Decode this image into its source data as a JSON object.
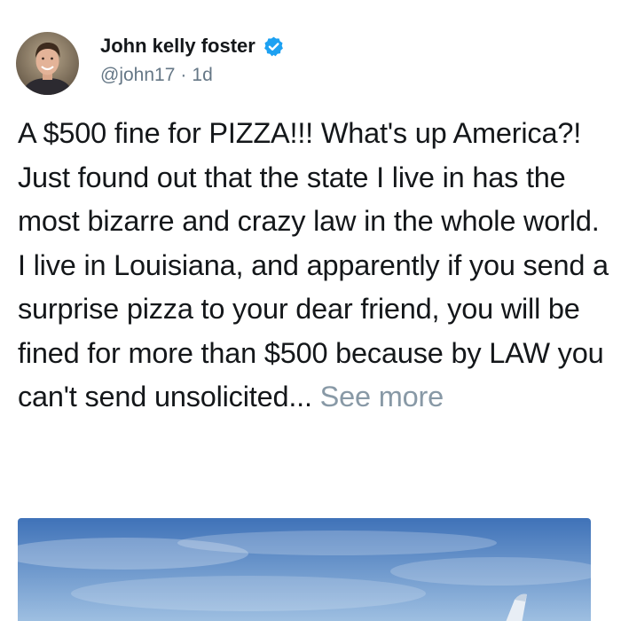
{
  "author": {
    "display_name": "John kelly foster",
    "handle": "@john17",
    "separator": "·",
    "timestamp": "1d",
    "verified": true,
    "avatar_icon": "avatar-photo",
    "verified_icon": "verified-badge-icon",
    "verified_color": "#1da1f2"
  },
  "tweet": {
    "text": "A $500 fine for PIZZA!!! What's up America?! Just found out that the state I live in has the most bizarre and crazy law in the whole world. I live in Louisiana, and apparently if you send a surprise pizza to your dear friend, you will be fined for more than $500 because by LAW you can't send unsolicited...",
    "see_more_label": "See more"
  },
  "media": {
    "type": "photo",
    "description_icon": "sky-photo"
  },
  "colors": {
    "text": "#14171a",
    "secondary": "#657786",
    "see_more": "#8899a6",
    "sky_top": "#3f72b8",
    "sky_bottom": "#a9c8e6"
  }
}
